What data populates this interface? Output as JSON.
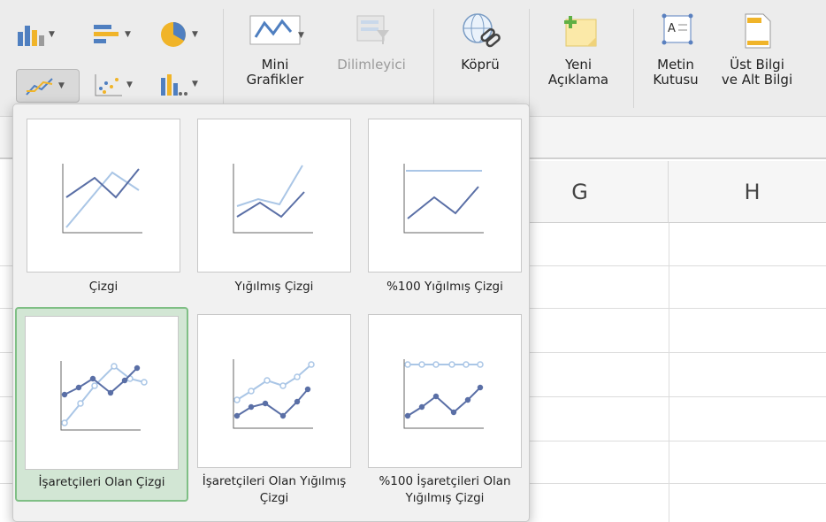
{
  "ribbon": {
    "mini_charts_label": "Mini\nGrafikler",
    "slicer_label": "Dilimleyici",
    "hyperlink_label": "Köprü",
    "new_comment_label": "Yeni\nAçıklama",
    "text_box_label": "Metin\nKutusu",
    "header_footer_label": "Üst Bilgi\nve Alt Bilgi"
  },
  "sheet": {
    "columns": [
      "G",
      "H"
    ]
  },
  "gallery": {
    "items": [
      {
        "label": "Çizgi"
      },
      {
        "label": "Yığılmış Çizgi"
      },
      {
        "label": "%100 Yığılmış Çizgi"
      },
      {
        "label": "İşaretçileri Olan Çizgi",
        "selected": true
      },
      {
        "label": "İşaretçileri Olan Yığılmış\nÇizgi"
      },
      {
        "label": "%100 İşaretçileri Olan\nYığılmış Çizgi"
      }
    ]
  },
  "colors": {
    "dark_series": "#5a6fa6",
    "light_series": "#aac6e6",
    "selected_bg": "#d2e6d4",
    "selected_border": "#7fbf85"
  }
}
